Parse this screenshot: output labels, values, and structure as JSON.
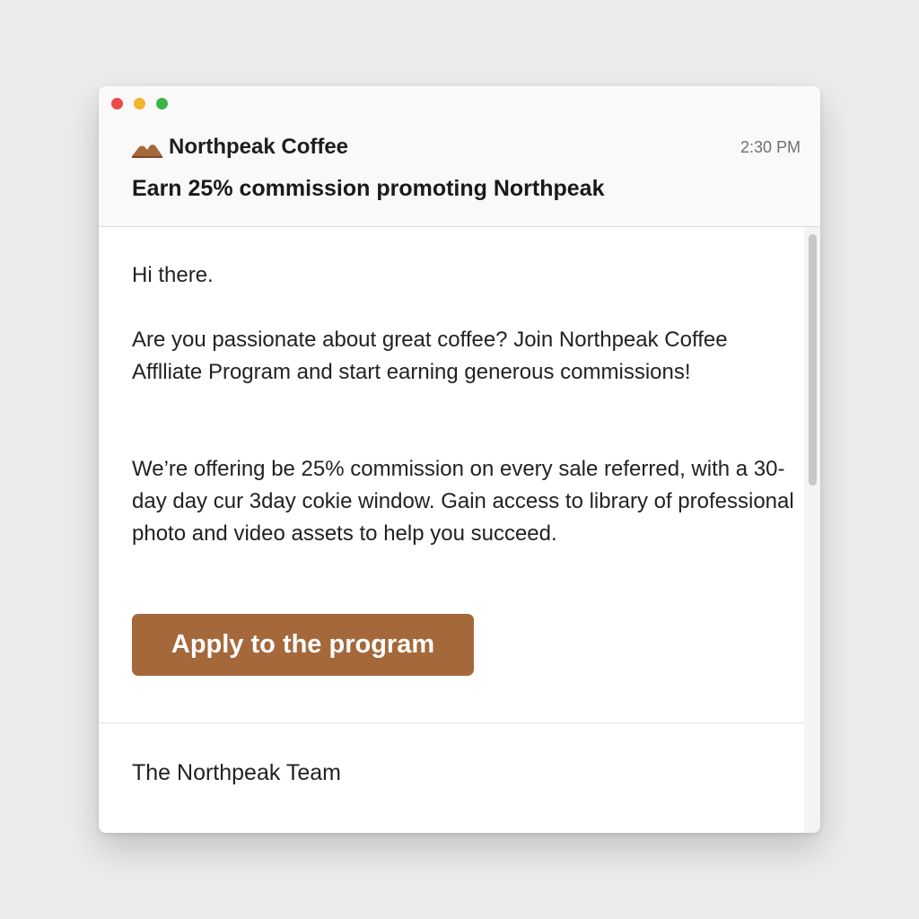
{
  "window": {
    "controls": [
      "close",
      "minimize",
      "zoom"
    ]
  },
  "email": {
    "sender": "Northpeak Coffee",
    "sender_logo_icon": "mountain-logo-icon",
    "time": "2:30 PM",
    "subject": "Earn 25% commission promoting Northpeak",
    "greeting": "Hi there.",
    "intro": "Are you passionate about great coffee? Join Northpeak Coffee Afflliate Program and start earning generous commissions!",
    "offer": "We’re offering be 25% commission on every sale referred, with a 30-day day cur 3day cokie window. Gain access to library of professional photo and video assets to help you succeed.",
    "cta_label": "Apply to the program",
    "signature": "The Northpeak Team"
  },
  "colors": {
    "accent": "#a5683a",
    "close": "#ed4b4b",
    "minimize": "#f1b52e",
    "zoom": "#3cb44a"
  }
}
